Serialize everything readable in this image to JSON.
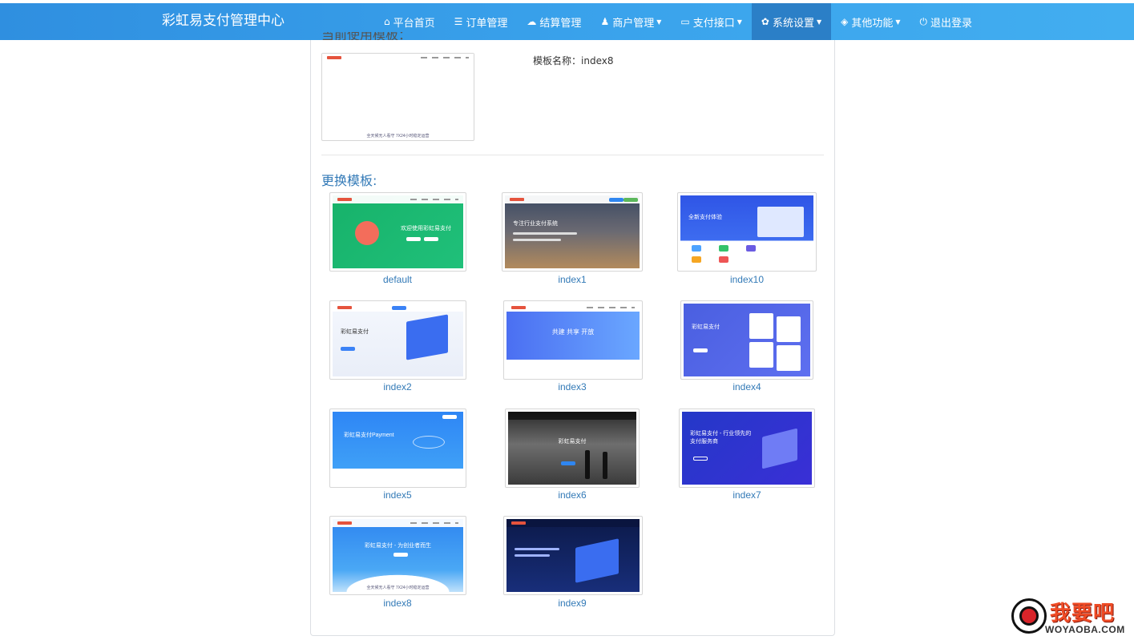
{
  "navbar": {
    "brand": "彩虹易支付管理中心",
    "items": [
      {
        "label": "平台首页",
        "icon": "home-icon",
        "glyph": "⌂",
        "dropdown": false
      },
      {
        "label": "订单管理",
        "icon": "list-icon",
        "glyph": "☰",
        "dropdown": false
      },
      {
        "label": "结算管理",
        "icon": "cloud-icon",
        "glyph": "☁",
        "dropdown": false
      },
      {
        "label": "商户管理",
        "icon": "user-icon",
        "glyph": "♟",
        "dropdown": true
      },
      {
        "label": "支付接口",
        "icon": "credit-card-icon",
        "glyph": "▭",
        "dropdown": true
      },
      {
        "label": "系统设置",
        "icon": "gear-icon",
        "glyph": "✿",
        "dropdown": true,
        "active": true
      },
      {
        "label": "其他功能",
        "icon": "cube-icon",
        "glyph": "◈",
        "dropdown": true
      },
      {
        "label": "退出登录",
        "icon": "power-icon",
        "glyph": "⏻",
        "dropdown": false
      }
    ],
    "colors": {
      "bar": "#3aa3ec",
      "active": "#2b7fc7"
    }
  },
  "current": {
    "heading": "当前使用模板：",
    "name_label": "模板名称：",
    "name_value": "index8"
  },
  "change": {
    "heading": "更换模板:",
    "templates": [
      {
        "name": "default"
      },
      {
        "name": "index1"
      },
      {
        "name": "index10"
      },
      {
        "name": "index2"
      },
      {
        "name": "index3"
      },
      {
        "name": "index4"
      },
      {
        "name": "index5"
      },
      {
        "name": "index6"
      },
      {
        "name": "index7"
      },
      {
        "name": "index8"
      },
      {
        "name": "index9"
      }
    ]
  },
  "thumb_text": {
    "index8_title": "彩虹易支付 - 为创业者而生",
    "index8_footer": "全天候无人看守 7X24小时稳定运营",
    "default_title": "欢迎使用彩虹易支付",
    "index1_title": "专注行业支付系统",
    "index10_title": "全新支付体验",
    "index2_title": "彩虹易支付",
    "index3_title": "共建  共享  开放",
    "index4_title": "彩虹易支付",
    "index5_title": "彩虹易支付Payment",
    "index6_title": "彩虹易支付",
    "index7_title": "彩虹易支付 - 行业领先的支付服务商"
  },
  "watermark": {
    "big": "我要吧",
    "small": "WOYAOBA.COM"
  }
}
